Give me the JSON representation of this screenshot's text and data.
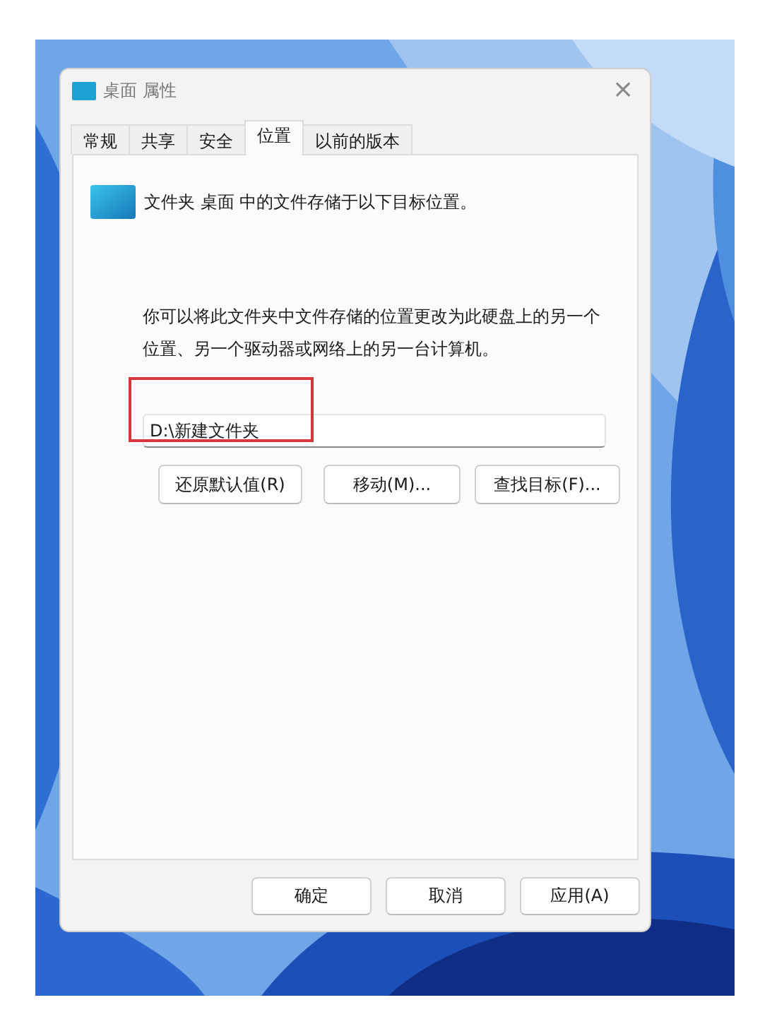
{
  "window": {
    "title": "桌面 属性",
    "close_glyph": "×"
  },
  "tabs": [
    {
      "label": "常规",
      "selected": false
    },
    {
      "label": "共享",
      "selected": false
    },
    {
      "label": "安全",
      "selected": false
    },
    {
      "label": "位置",
      "selected": true
    },
    {
      "label": "以前的版本",
      "selected": false
    }
  ],
  "location": {
    "heading": "文件夹 桌面 中的文件存储于以下目标位置。",
    "description": "你可以将此文件夹中文件存储的位置更改为此硬盘上的另一个位置、另一个驱动器或网络上的另一台计算机。",
    "path_field": {
      "value": "D:\\新建文件夹",
      "highlighted": true
    },
    "buttons": [
      "还原默认值(R)",
      "移动(M)...",
      "查找目标(F)..."
    ]
  },
  "footer_buttons": [
    "确定",
    "取消",
    "应用(A)"
  ]
}
